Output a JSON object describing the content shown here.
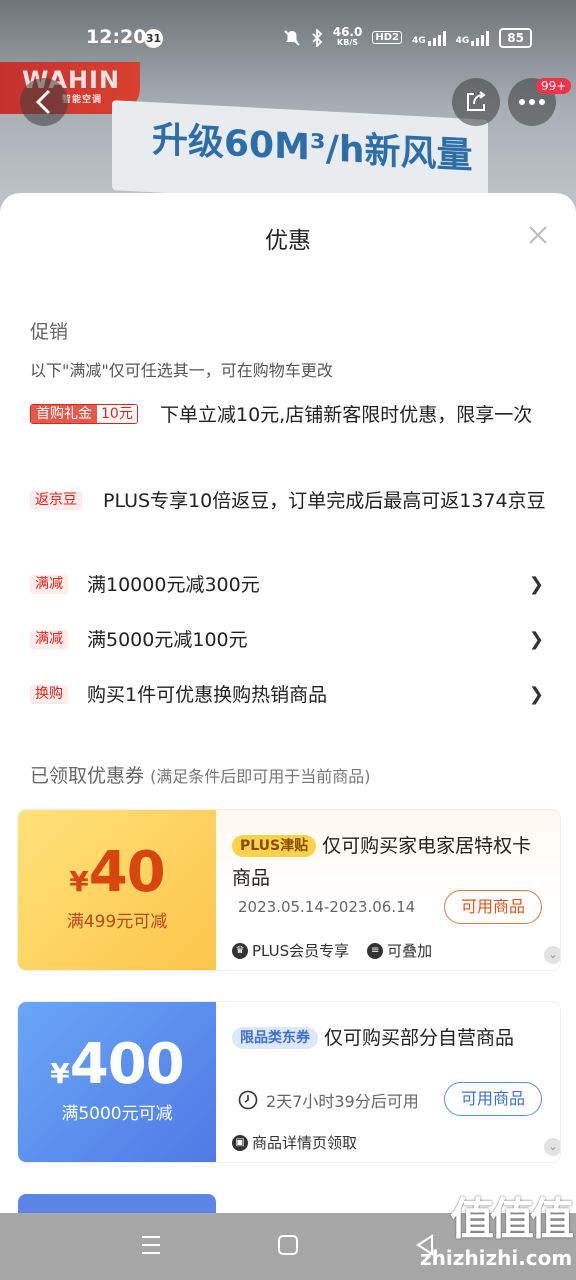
{
  "status_bar": {
    "time": "12:20",
    "notification_count": "31",
    "net_speed": "46.0",
    "net_unit": "KB/S",
    "hd": "HD2",
    "sig1": "4G",
    "sig2": "4G",
    "battery": "85"
  },
  "background": {
    "brand": "WAHIN",
    "brand_sub": "智能空调",
    "banner_text": "升级60M³/h新风量",
    "more_badge": "99+"
  },
  "sheet": {
    "title": "优惠",
    "promo_section": {
      "title": "促销",
      "note": "以下\"满减\"仅可任选其一，可在购物车更改",
      "items": [
        {
          "tag": "首购礼金",
          "tag_value": "10元",
          "text": "下单立减10元,店铺新客限时优惠，限享一次"
        },
        {
          "tag": "返京豆",
          "text": "PLUS专享10倍返豆，订单完成后最高可返1374京豆"
        },
        {
          "tag": "满减",
          "text": "满10000元减300元"
        },
        {
          "tag": "满减",
          "text": "满5000元减100元"
        },
        {
          "tag": "换购",
          "text": "购买1件可优惠换购热销商品"
        }
      ]
    },
    "coupon_section": {
      "title": "已领取优惠券",
      "note": "(满足条件后即可用于当前商品)",
      "coupons": [
        {
          "currency": "¥",
          "amount": "40",
          "condition": "满499元可减",
          "badge": "PLUS津贴",
          "title": "仅可购买家电家居特权卡商品",
          "date": "2023.05.14-2023.06.14",
          "button": "可用商品",
          "features": [
            "PLUS会员专享",
            "可叠加"
          ]
        },
        {
          "currency": "¥",
          "amount": "400",
          "condition": "满5000元可减",
          "badge": "限品类东券",
          "title": "仅可购买部分自营商品",
          "time_left": "2天7小时39分后可用",
          "button": "可用商品",
          "features": [
            "商品详情页领取"
          ]
        }
      ]
    }
  },
  "watermark": {
    "chars": "值值值",
    "url": "zhizhizhi.com"
  },
  "colors": {
    "accent_red": "#e2231a",
    "gold": "#fbc54a",
    "blue": "#4f7ae4"
  }
}
